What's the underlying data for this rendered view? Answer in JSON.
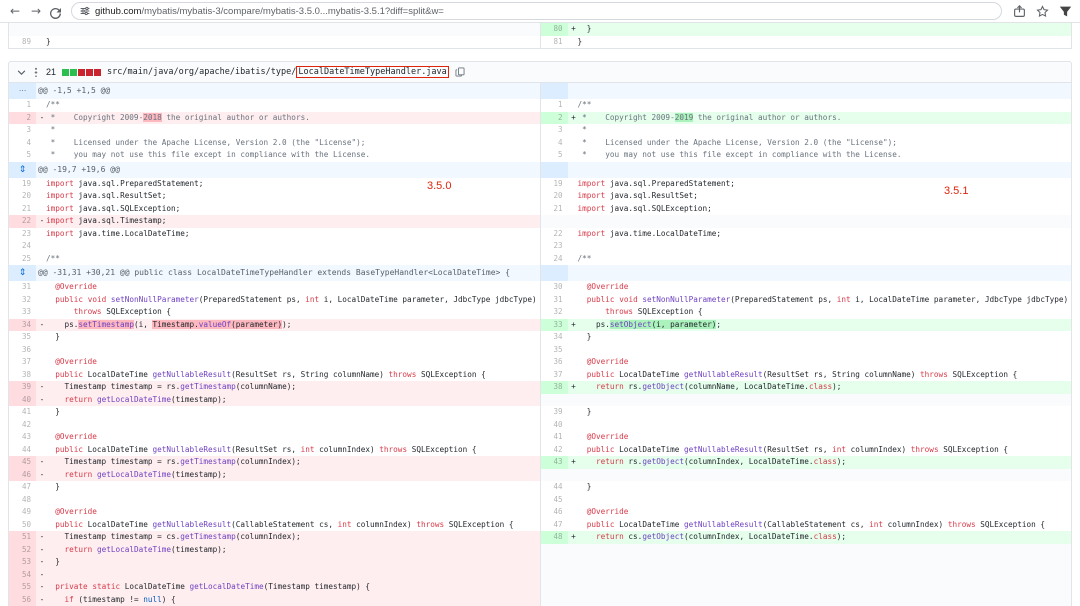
{
  "browser": {
    "url_host": "github.com",
    "url_path": "/mybatis/mybatis-3/compare/mybatis-3.5.0...mybatis-3.5.1?diff=split&w="
  },
  "file_header": {
    "changes_count": "21",
    "blocks": [
      "#2cbe4e",
      "#2cbe4e",
      "#cb2431",
      "#cb2431",
      "#cb2431"
    ],
    "path_prefix": "src/main/java/org/apache/ibatis/type/",
    "file_name": "LocalDateTimeTypeHandler.java"
  },
  "annotations": {
    "left_label": "3.5.0",
    "right_label": "3.5.1"
  },
  "icons": {
    "dots": "⋯",
    "expand": "⇕",
    "back": "←",
    "forward": "→"
  },
  "colors": {
    "addition_bg": "#e6ffed",
    "deletion_bg": "#ffeef0",
    "annotation_red": "#e0240b"
  },
  "top_partial_rows": [
    {
      "l": 0,
      "r": {
        "n": "80",
        "m": "+",
        "s": [
          [
            "  }",
            "p"
          ]
        ]
      }
    },
    {
      "c": [
        [
          "}",
          "p"
        ]
      ],
      "ln": "89",
      "rn": "81"
    }
  ],
  "diff_rows": [
    {
      "h": 1,
      "g": "dots",
      "t": "@@ -1,5 +1,5 @@"
    },
    {
      "c": [
        [
          "/**",
          "c"
        ]
      ],
      "ln": "1",
      "rn": "1"
    },
    {
      "l": {
        "n": "2",
        "m": "-",
        "s": [
          [
            " *    Copyright 2009-",
            "c"
          ],
          [
            "2018",
            "c hl"
          ],
          [
            " the original author or authors.",
            "c"
          ]
        ]
      },
      "r": {
        "n": "2",
        "m": "+",
        "s": [
          [
            " *    Copyright 2009-",
            "c"
          ],
          [
            "2019",
            "c hl"
          ],
          [
            " the original author or authors.",
            "c"
          ]
        ]
      }
    },
    {
      "c": [
        [
          " *",
          "c"
        ]
      ],
      "ln": "3",
      "rn": "3"
    },
    {
      "c": [
        [
          " *    Licensed under the Apache License, Version 2.0 (the \"License\");",
          "c"
        ]
      ],
      "ln": "4",
      "rn": "4"
    },
    {
      "c": [
        [
          " *    you may not use this file except in compliance with the License.",
          "c"
        ]
      ],
      "ln": "5",
      "rn": "5"
    },
    {
      "h": 1,
      "g": "expand",
      "t": "@@ -19,7 +19,6 @@"
    },
    {
      "c": [
        [
          "import",
          "k"
        ],
        [
          " java.sql.PreparedStatement;",
          "p"
        ]
      ],
      "ln": "19",
      "rn": "19"
    },
    {
      "c": [
        [
          "import",
          "k"
        ],
        [
          " java.sql.ResultSet;",
          "p"
        ]
      ],
      "ln": "20",
      "rn": "20"
    },
    {
      "c": [
        [
          "import",
          "k"
        ],
        [
          " java.sql.SQLException;",
          "p"
        ]
      ],
      "ln": "21",
      "rn": "21"
    },
    {
      "l": {
        "n": "22",
        "m": "-",
        "s": [
          [
            "import",
            "k"
          ],
          [
            " java.sql.Timestamp;",
            "p"
          ]
        ]
      },
      "r": 0
    },
    {
      "c": [
        [
          "import",
          "k"
        ],
        [
          " java.time.LocalDateTime;",
          "p"
        ]
      ],
      "ln": "23",
      "rn": "22"
    },
    {
      "c": [
        [
          "",
          "p"
        ]
      ],
      "ln": "24",
      "rn": "23"
    },
    {
      "c": [
        [
          "/**",
          "c"
        ]
      ],
      "ln": "25",
      "rn": "24"
    },
    {
      "h": 1,
      "g": "expand",
      "t": "@@ -31,31 +30,21 @@ public class LocalDateTimeTypeHandler extends BaseTypeHandler<LocalDateTime> {"
    },
    {
      "c": [
        [
          "  @Override",
          "k"
        ]
      ],
      "ln": "31",
      "rn": "30"
    },
    {
      "c": [
        [
          "  ",
          "p"
        ],
        [
          "public",
          "k"
        ],
        [
          " ",
          "p"
        ],
        [
          "void",
          "k"
        ],
        [
          " ",
          "p"
        ],
        [
          "setNonNullParameter",
          "e"
        ],
        [
          "(PreparedStatement ps, ",
          "p"
        ],
        [
          "int",
          "k"
        ],
        [
          " i, LocalDateTime parameter, JdbcType jdbcType)",
          "p"
        ]
      ],
      "ln": "32",
      "rn": "31"
    },
    {
      "c": [
        [
          "      ",
          "p"
        ],
        [
          "throws",
          "k"
        ],
        [
          " SQLException {",
          "p"
        ]
      ],
      "ln": "33",
      "rn": "32"
    },
    {
      "l": {
        "n": "34",
        "m": "-",
        "s": [
          [
            "    ps.",
            "p"
          ],
          [
            "setTimestamp",
            "e hl"
          ],
          [
            "(i, ",
            "p"
          ],
          [
            "Timestamp.",
            "p hl"
          ],
          [
            "valueOf",
            "e hl"
          ],
          [
            "(parameter)",
            "p hl"
          ],
          [
            ");",
            "p"
          ]
        ]
      },
      "r": {
        "n": "33",
        "m": "+",
        "s": [
          [
            "    ps.",
            "p"
          ],
          [
            "setObject",
            "e hl"
          ],
          [
            "(i, parameter)",
            "p hl"
          ],
          [
            ";",
            "p"
          ]
        ]
      }
    },
    {
      "c": [
        [
          "  }",
          "p"
        ]
      ],
      "ln": "35",
      "rn": "34"
    },
    {
      "c": [
        [
          "",
          "p"
        ]
      ],
      "ln": "36",
      "rn": "35"
    },
    {
      "c": [
        [
          "  @Override",
          "k"
        ]
      ],
      "ln": "37",
      "rn": "36"
    },
    {
      "c": [
        [
          "  ",
          "p"
        ],
        [
          "public",
          "k"
        ],
        [
          " LocalDateTime ",
          "p"
        ],
        [
          "getNullableResult",
          "e"
        ],
        [
          "(ResultSet rs, String columnName) ",
          "p"
        ],
        [
          "throws",
          "k"
        ],
        [
          " SQLException {",
          "p"
        ]
      ],
      "ln": "38",
      "rn": "37"
    },
    {
      "l": {
        "n": "39",
        "m": "-",
        "s": [
          [
            "    Timestamp timestamp = rs.",
            "p"
          ],
          [
            "getTimestamp",
            "e"
          ],
          [
            "(columnName);",
            "p"
          ]
        ]
      },
      "r": {
        "n": "38",
        "m": "+",
        "s": [
          [
            "    ",
            "p"
          ],
          [
            "return",
            "k"
          ],
          [
            " rs.",
            "p"
          ],
          [
            "getObject",
            "e"
          ],
          [
            "(columnName, LocalDateTime.",
            "p"
          ],
          [
            "class",
            "k"
          ],
          [
            ");",
            "p"
          ]
        ]
      }
    },
    {
      "l": {
        "n": "40",
        "m": "-",
        "s": [
          [
            "    ",
            "p"
          ],
          [
            "return",
            "k"
          ],
          [
            " ",
            "p"
          ],
          [
            "getLocalDateTime",
            "e"
          ],
          [
            "(timestamp);",
            "p"
          ]
        ]
      },
      "r": 0
    },
    {
      "c": [
        [
          "  }",
          "p"
        ]
      ],
      "ln": "41",
      "rn": "39"
    },
    {
      "c": [
        [
          "",
          "p"
        ]
      ],
      "ln": "42",
      "rn": "40"
    },
    {
      "c": [
        [
          "  @Override",
          "k"
        ]
      ],
      "ln": "43",
      "rn": "41"
    },
    {
      "c": [
        [
          "  ",
          "p"
        ],
        [
          "public",
          "k"
        ],
        [
          " LocalDateTime ",
          "p"
        ],
        [
          "getNullableResult",
          "e"
        ],
        [
          "(ResultSet rs, ",
          "p"
        ],
        [
          "int",
          "k"
        ],
        [
          " columnIndex) ",
          "p"
        ],
        [
          "throws",
          "k"
        ],
        [
          " SQLException {",
          "p"
        ]
      ],
      "ln": "44",
      "rn": "42"
    },
    {
      "l": {
        "n": "45",
        "m": "-",
        "s": [
          [
            "    Timestamp timestamp = rs.",
            "p"
          ],
          [
            "getTimestamp",
            "e"
          ],
          [
            "(columnIndex);",
            "p"
          ]
        ]
      },
      "r": {
        "n": "43",
        "m": "+",
        "s": [
          [
            "    ",
            "p"
          ],
          [
            "return",
            "k"
          ],
          [
            " rs.",
            "p"
          ],
          [
            "getObject",
            "e"
          ],
          [
            "(columnIndex, LocalDateTime.",
            "p"
          ],
          [
            "class",
            "k"
          ],
          [
            ");",
            "p"
          ]
        ]
      }
    },
    {
      "l": {
        "n": "46",
        "m": "-",
        "s": [
          [
            "    ",
            "p"
          ],
          [
            "return",
            "k"
          ],
          [
            " ",
            "p"
          ],
          [
            "getLocalDateTime",
            "e"
          ],
          [
            "(timestamp);",
            "p"
          ]
        ]
      },
      "r": 0
    },
    {
      "c": [
        [
          "  }",
          "p"
        ]
      ],
      "ln": "47",
      "rn": "44"
    },
    {
      "c": [
        [
          "",
          "p"
        ]
      ],
      "ln": "48",
      "rn": "45"
    },
    {
      "c": [
        [
          "  @Override",
          "k"
        ]
      ],
      "ln": "49",
      "rn": "46"
    },
    {
      "c": [
        [
          "  ",
          "p"
        ],
        [
          "public",
          "k"
        ],
        [
          " LocalDateTime ",
          "p"
        ],
        [
          "getNullableResult",
          "e"
        ],
        [
          "(CallableStatement cs, ",
          "p"
        ],
        [
          "int",
          "k"
        ],
        [
          " columnIndex) ",
          "p"
        ],
        [
          "throws",
          "k"
        ],
        [
          " SQLException {",
          "p"
        ]
      ],
      "ln": "50",
      "rn": "47"
    },
    {
      "l": {
        "n": "51",
        "m": "-",
        "s": [
          [
            "    Timestamp timestamp = cs.",
            "p"
          ],
          [
            "getTimestamp",
            "e"
          ],
          [
            "(columnIndex);",
            "p"
          ]
        ]
      },
      "r": {
        "n": "48",
        "m": "+",
        "s": [
          [
            "    ",
            "p"
          ],
          [
            "return",
            "k"
          ],
          [
            " cs.",
            "p"
          ],
          [
            "getObject",
            "e"
          ],
          [
            "(columnIndex, LocalDateTime.",
            "p"
          ],
          [
            "class",
            "k"
          ],
          [
            ");",
            "p"
          ]
        ]
      }
    },
    {
      "l": {
        "n": "52",
        "m": "-",
        "s": [
          [
            "    ",
            "p"
          ],
          [
            "return",
            "k"
          ],
          [
            " ",
            "p"
          ],
          [
            "getLocalDateTime",
            "e"
          ],
          [
            "(timestamp);",
            "p"
          ]
        ]
      },
      "r": 0
    },
    {
      "l": {
        "n": "53",
        "m": "-",
        "s": [
          [
            "  }",
            "p"
          ]
        ]
      },
      "r": 0
    },
    {
      "l": {
        "n": "54",
        "m": "-",
        "s": [
          [
            "",
            "p"
          ]
        ]
      },
      "r": 0
    },
    {
      "l": {
        "n": "55",
        "m": "-",
        "s": [
          [
            "  ",
            "p"
          ],
          [
            "private",
            "k"
          ],
          [
            " ",
            "p"
          ],
          [
            "static",
            "k"
          ],
          [
            " LocalDateTime ",
            "p"
          ],
          [
            "getLocalDateTime",
            "e"
          ],
          [
            "(Timestamp timestamp) {",
            "p"
          ]
        ]
      },
      "r": 0
    },
    {
      "l": {
        "n": "56",
        "m": "-",
        "s": [
          [
            "    ",
            "p"
          ],
          [
            "if",
            "k"
          ],
          [
            " (timestamp != ",
            "p"
          ],
          [
            "null",
            "n"
          ],
          [
            ") {",
            "p"
          ]
        ]
      },
      "r": 0
    }
  ]
}
